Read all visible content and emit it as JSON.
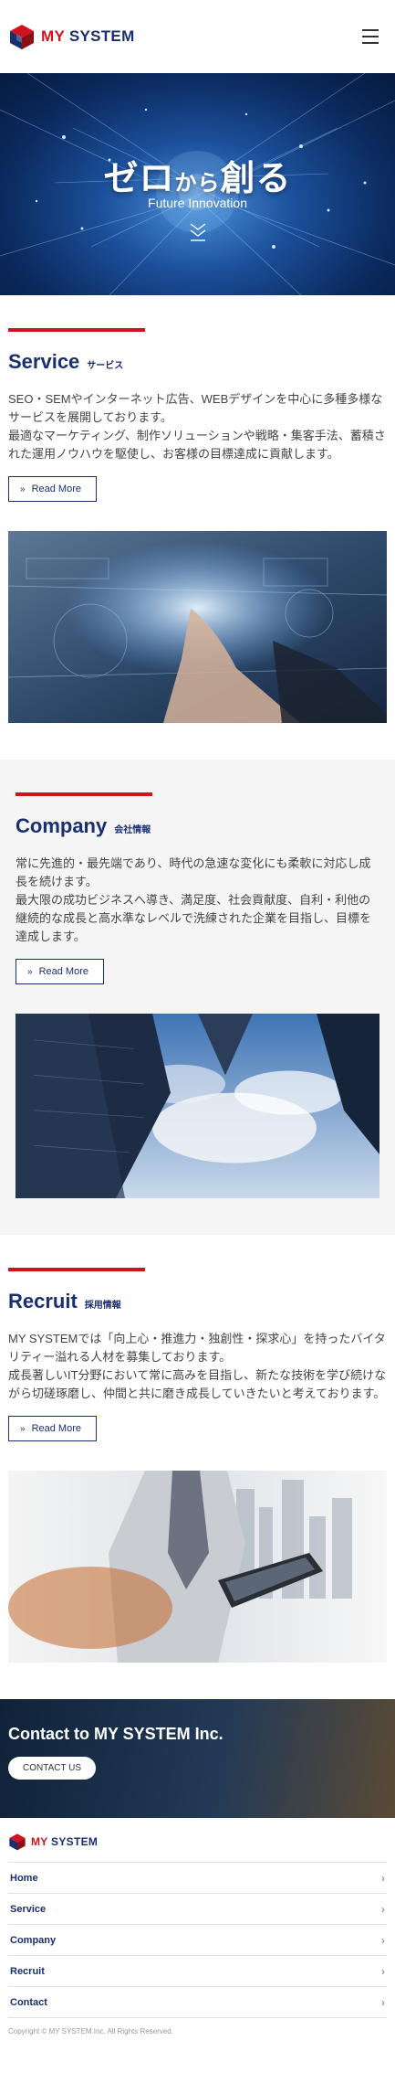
{
  "header": {
    "logo_text_prefix": "MY",
    "logo_text_suffix": "SYSTEM",
    "menu_icon": "hamburger-icon"
  },
  "hero": {
    "title_part1": "ゼロ",
    "title_part2": "から",
    "title_part3": "創る",
    "subtitle": "Future Innovation"
  },
  "sections": [
    {
      "title_en": "Service",
      "title_jp": "サービス",
      "body": "SEO・SEMやインターネット広告、WEBデザインを中心に多種多様なサービスを展開しております。\n最適なマーケティング、制作ソリューションや戦略・集客手法、蓄積された運用ノウハウを駆使し、お客様の目標達成に貢献します。",
      "button": "Read More"
    },
    {
      "title_en": "Company",
      "title_jp": "会社情報",
      "body": "常に先進的・最先端であり、時代の急速な変化にも柔軟に対応し成長を続けます。\n最大限の成功ビジネスへ導き、満足度、社会貢献度、自利・利他の継続的な成長と高水準なレベルで洗練された企業を目指し、目標を達成します。",
      "button": "Read More"
    },
    {
      "title_en": "Recruit",
      "title_jp": "採用情報",
      "body": "MY SYSTEMでは「向上心・推進力・独創性・探求心」を持ったバイタリティー溢れる人材を募集しております。\n成長著しいIT分野において常に高みを目指し、新たな技術を学び続けながら切磋琢磨し、仲間と共に磨き成長していきたいと考えております。",
      "button": "Read More"
    }
  ],
  "contact": {
    "title": "Contact to MY SYSTEM Inc.",
    "button": "CONTACT US"
  },
  "footer": {
    "logo_text_prefix": "MY",
    "logo_text_suffix": "SYSTEM",
    "nav": [
      "Home",
      "Service",
      "Company",
      "Recruit",
      "Contact"
    ],
    "copyright": "Copyright © MY SYSTEM Inc. All Rights Reserved."
  },
  "colors": {
    "brand_navy": "#1a2f6f",
    "brand_red": "#d0131f"
  }
}
